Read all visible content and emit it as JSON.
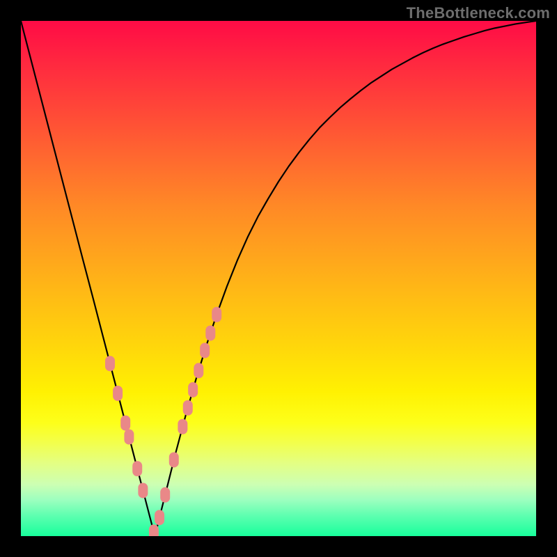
{
  "watermark_text": "TheBottleneck.com",
  "chart_data": {
    "type": "line",
    "title": "",
    "xlabel": "",
    "ylabel": "",
    "xlim": [
      0,
      1
    ],
    "ylim": [
      0,
      1
    ],
    "series": [
      {
        "name": "bottleneck-curve",
        "x": [
          0.0,
          0.02,
          0.04,
          0.06,
          0.08,
          0.1,
          0.12,
          0.14,
          0.16,
          0.18,
          0.2,
          0.22,
          0.24,
          0.26,
          0.28,
          0.3,
          0.32,
          0.34,
          0.36,
          0.38,
          0.4,
          0.42,
          0.44,
          0.46,
          0.48,
          0.5,
          0.52,
          0.54,
          0.56,
          0.58,
          0.6,
          0.62,
          0.64,
          0.66,
          0.68,
          0.7,
          0.72,
          0.74,
          0.76,
          0.78,
          0.8,
          0.82,
          0.84,
          0.86,
          0.88,
          0.9,
          0.92,
          0.94,
          0.96,
          0.98,
          1.0
        ],
        "y": [
          1.0,
          0.923,
          0.846,
          0.769,
          0.692,
          0.615,
          0.538,
          0.462,
          0.385,
          0.308,
          0.231,
          0.154,
          0.077,
          0.0,
          0.08,
          0.16,
          0.235,
          0.305,
          0.37,
          0.43,
          0.485,
          0.535,
          0.58,
          0.62,
          0.655,
          0.688,
          0.718,
          0.745,
          0.77,
          0.793,
          0.813,
          0.832,
          0.849,
          0.865,
          0.88,
          0.893,
          0.906,
          0.917,
          0.928,
          0.938,
          0.947,
          0.955,
          0.962,
          0.969,
          0.975,
          0.981,
          0.986,
          0.99,
          0.994,
          0.997,
          1.0
        ]
      }
    ],
    "markers": {
      "name": "highlighted-region",
      "x_fraction": [
        0.173,
        0.188,
        0.203,
        0.21,
        0.226,
        0.237,
        0.258,
        0.269,
        0.28,
        0.297,
        0.314,
        0.324,
        0.334,
        0.345,
        0.357,
        0.368,
        0.38
      ],
      "color": "#e98888"
    }
  }
}
